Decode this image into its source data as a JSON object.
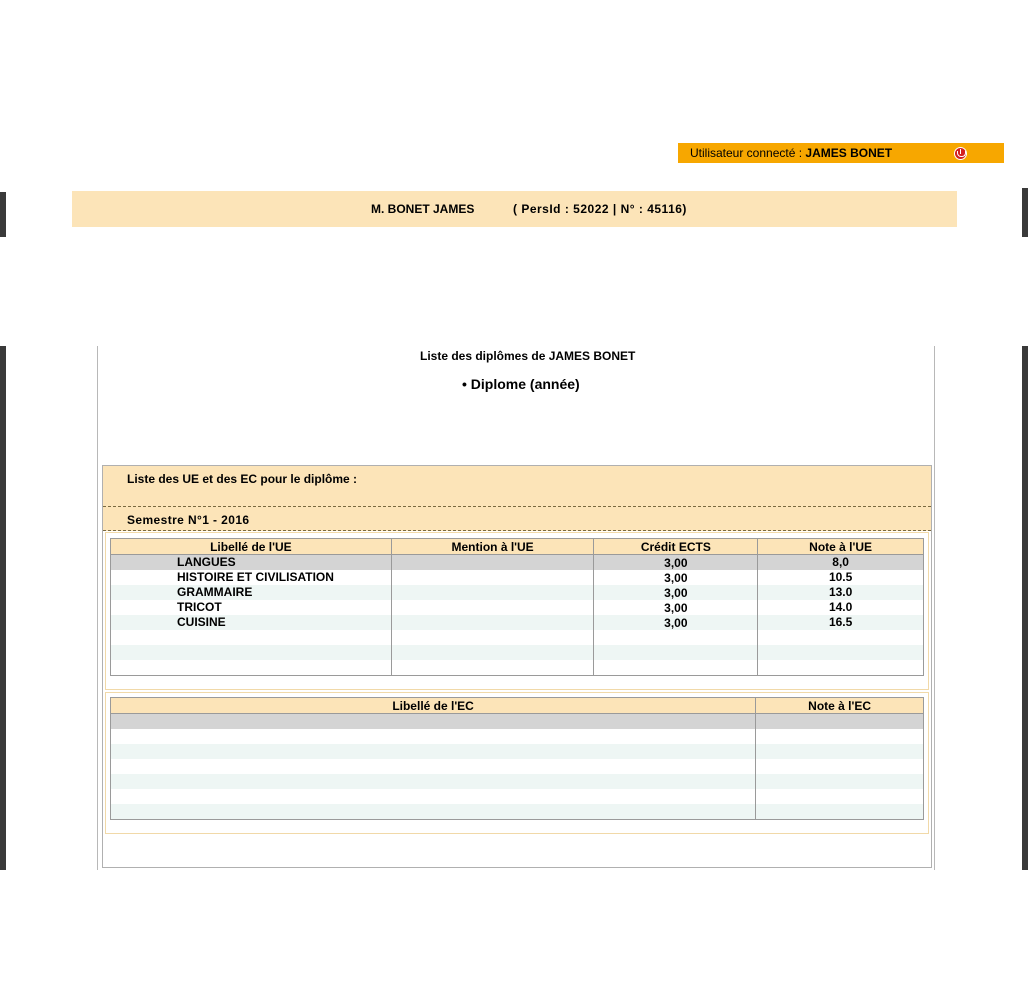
{
  "user_bar": {
    "label": "Utilisateur connecté : ",
    "user_name": "JAMES BONET",
    "icon": "logout-icon"
  },
  "person_band": {
    "name": "M. BONET JAMES",
    "ids": "( PersId : 52022 | N° : 45116)"
  },
  "main": {
    "title_prefix": "Liste des diplômes de ",
    "title_name": "JAMES BONET",
    "diploma_item": "• Diplome (année)",
    "section_title": "Liste des UE et des EC pour le diplôme :",
    "semester": "Semestre N°1 - 2016"
  },
  "ue_table": {
    "headers": [
      "Libellé de l'UE",
      "Mention à l'UE",
      "Crédit ECTS",
      "Note à l'UE"
    ],
    "rows": [
      {
        "label": "LANGUES",
        "mention": "",
        "credit": "3,00",
        "note": "8,0"
      },
      {
        "label": "HISTOIRE ET CIVILISATION",
        "mention": "",
        "credit": "3,00",
        "note": "10.5"
      },
      {
        "label": "GRAMMAIRE",
        "mention": "",
        "credit": "3,00",
        "note": "13.0"
      },
      {
        "label": "TRICOT",
        "mention": "",
        "credit": "3,00",
        "note": "14.0"
      },
      {
        "label": "CUISINE",
        "mention": "",
        "credit": "3,00",
        "note": "16.5"
      },
      {
        "label": "",
        "mention": "",
        "credit": "",
        "note": ""
      },
      {
        "label": "",
        "mention": "",
        "credit": "",
        "note": ""
      },
      {
        "label": "",
        "mention": "",
        "credit": "",
        "note": ""
      }
    ]
  },
  "ec_table": {
    "headers": [
      "Libellé de l'EC",
      "Note à l'EC"
    ],
    "rows": [
      {
        "label": "",
        "note": ""
      },
      {
        "label": "",
        "note": ""
      },
      {
        "label": "",
        "note": ""
      },
      {
        "label": "",
        "note": ""
      },
      {
        "label": "",
        "note": ""
      },
      {
        "label": "",
        "note": ""
      },
      {
        "label": "",
        "note": ""
      }
    ]
  }
}
